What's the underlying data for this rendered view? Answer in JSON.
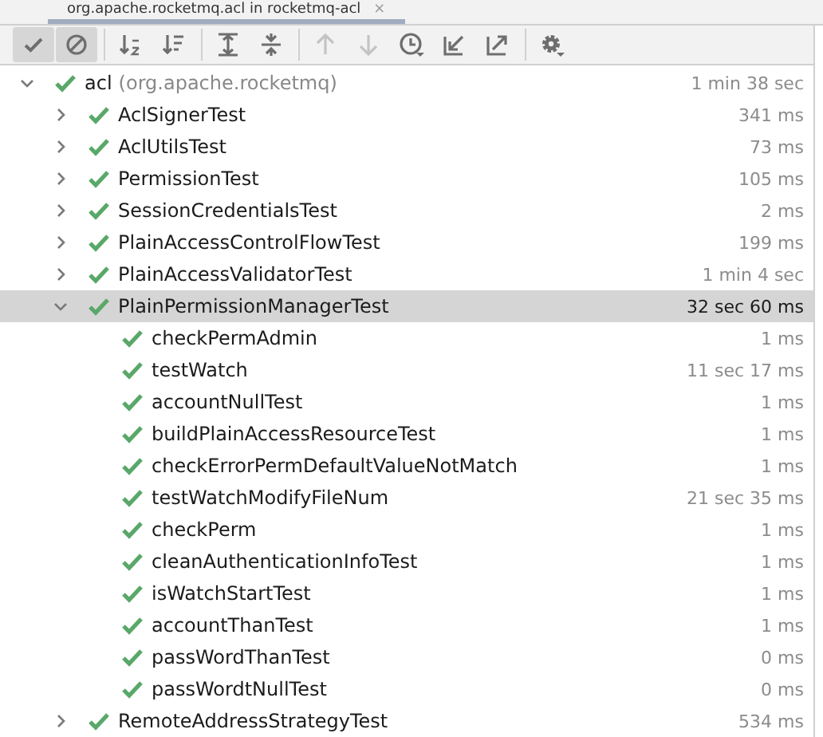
{
  "editor_tab": {
    "title": "org.apache.rocketmq.acl in rocketmq-acl",
    "close": "×"
  },
  "toolbar": [
    {
      "kind": "show-passed",
      "selected": true,
      "disabled": false
    },
    {
      "kind": "show-ignored",
      "selected": true,
      "disabled": false
    },
    {
      "kind": "sort-alpha",
      "selected": false,
      "disabled": false
    },
    {
      "kind": "sort-duration",
      "selected": false,
      "disabled": false
    },
    {
      "kind": "expand-all",
      "selected": false,
      "disabled": false
    },
    {
      "kind": "collapse-all",
      "selected": false,
      "disabled": false
    },
    {
      "kind": "previous",
      "selected": false,
      "disabled": true
    },
    {
      "kind": "next",
      "selected": false,
      "disabled": true
    },
    {
      "kind": "history",
      "selected": false,
      "disabled": false
    },
    {
      "kind": "import",
      "selected": false,
      "disabled": false
    },
    {
      "kind": "export",
      "selected": false,
      "disabled": false
    },
    {
      "kind": "settings",
      "selected": false,
      "disabled": false
    }
  ],
  "tree": [
    {
      "name": "acl",
      "detail": "(org.apache.rocketmq)",
      "time": "1 min 38 sec",
      "expanded": true,
      "selected": false,
      "children": [
        {
          "name": "AclSignerTest",
          "time": "341 ms",
          "expanded": false,
          "selected": false
        },
        {
          "name": "AclUtilsTest",
          "time": "73 ms",
          "expanded": false,
          "selected": false
        },
        {
          "name": "PermissionTest",
          "time": "105 ms",
          "expanded": false,
          "selected": false
        },
        {
          "name": "SessionCredentialsTest",
          "time": "2 ms",
          "expanded": false,
          "selected": false
        },
        {
          "name": "PlainAccessControlFlowTest",
          "time": "199 ms",
          "expanded": false,
          "selected": false
        },
        {
          "name": "PlainAccessValidatorTest",
          "time": "1 min 4 sec",
          "expanded": false,
          "selected": false
        },
        {
          "name": "PlainPermissionManagerTest",
          "time": "32 sec 60 ms",
          "expanded": true,
          "selected": true,
          "children": [
            {
              "name": "checkPermAdmin",
              "time": "1 ms",
              "selected": false
            },
            {
              "name": "testWatch",
              "time": "11 sec 17 ms",
              "selected": false
            },
            {
              "name": "accountNullTest",
              "time": "1 ms",
              "selected": false
            },
            {
              "name": "buildPlainAccessResourceTest",
              "time": "1 ms",
              "selected": false
            },
            {
              "name": "checkErrorPermDefaultValueNotMatch",
              "time": "1 ms",
              "selected": false
            },
            {
              "name": "testWatchModifyFileNum",
              "time": "21 sec 35 ms",
              "selected": false
            },
            {
              "name": "checkPerm",
              "time": "1 ms",
              "selected": false
            },
            {
              "name": "cleanAuthenticationInfoTest",
              "time": "1 ms",
              "selected": false
            },
            {
              "name": "isWatchStartTest",
              "time": "1 ms",
              "selected": false
            },
            {
              "name": "accountThanTest",
              "time": "1 ms",
              "selected": false
            },
            {
              "name": "passWordThanTest",
              "time": "0 ms",
              "selected": false
            },
            {
              "name": "passWordtNullTest",
              "time": "0 ms",
              "selected": false
            }
          ]
        },
        {
          "name": "RemoteAddressStrategyTest",
          "time": "534 ms",
          "expanded": false,
          "selected": false
        }
      ]
    }
  ]
}
